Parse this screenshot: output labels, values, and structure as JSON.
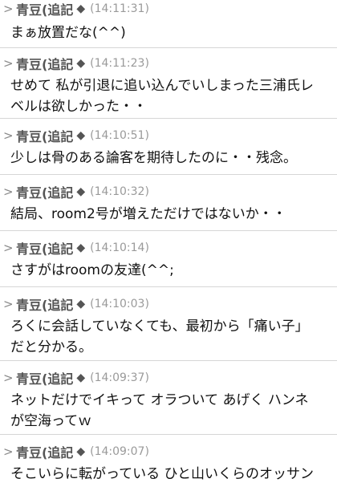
{
  "messages": [
    {
      "author": "青豆(追記",
      "separator": "◆",
      "time": "(14:11:31)",
      "lines": [
        "まぁ放置だな(^^)"
      ]
    },
    {
      "author": "青豆(追記",
      "separator": "◆",
      "time": "(14:11:23)",
      "lines": [
        "せめて 私が引退に追い込んでいしまった三浦氏レ",
        "ベルは欲しかった・・"
      ]
    },
    {
      "author": "青豆(追記",
      "separator": "◆",
      "time": "(14:10:51)",
      "lines": [
        "少しは骨のある論客を期待したのに・・残念。"
      ]
    },
    {
      "author": "青豆(追記",
      "separator": "◆",
      "time": "(14:10:32)",
      "lines": [
        "結局、room2号が増えただけではないか・・"
      ]
    },
    {
      "author": "青豆(追記",
      "separator": "◆",
      "time": "(14:10:14)",
      "lines": [
        "さすがはroomの友達(^^;"
      ]
    },
    {
      "author": "青豆(追記",
      "separator": "◆",
      "time": "(14:10:03)",
      "lines": [
        "ろくに会話していなくても、最初から「痛い子」",
        "だと分かる。"
      ]
    },
    {
      "author": "青豆(追記",
      "separator": "◆",
      "time": "(14:09:37)",
      "lines": [
        "ネットだけでイキって オラついて あげく ハンネ",
        "が空海ってｗ"
      ]
    },
    {
      "author": "青豆(追記",
      "separator": "◆",
      "time": "(14:09:07)",
      "lines": [
        "そこいらに転がっている ひと山いくらのオッサン"
      ]
    }
  ],
  "reply_marker": ">"
}
